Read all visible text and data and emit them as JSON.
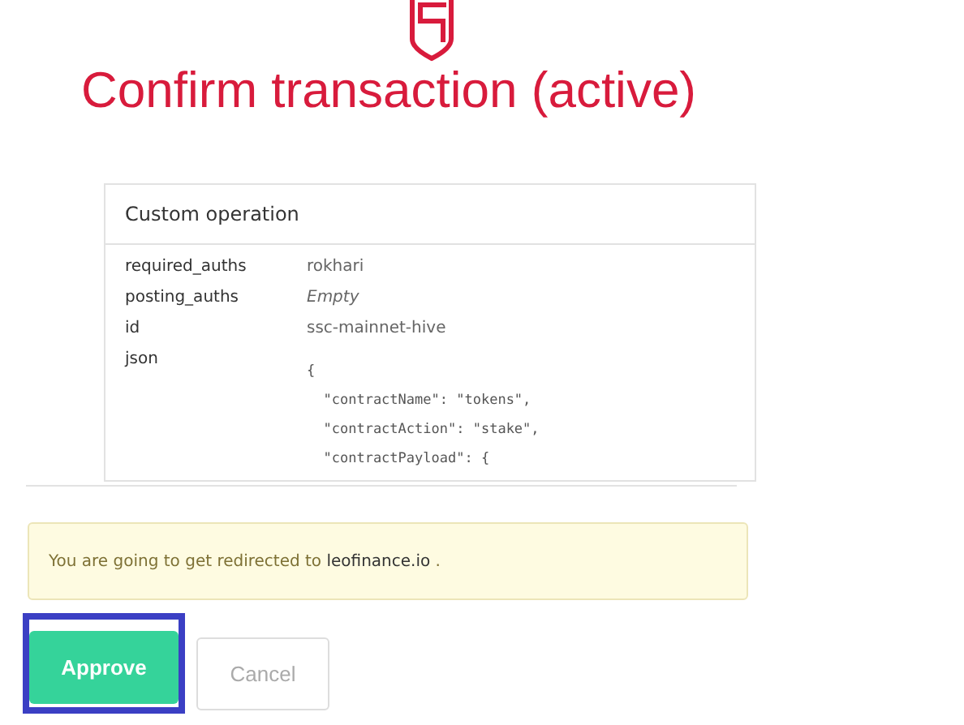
{
  "title": "Confirm transaction (active)",
  "operation": {
    "title": "Custom operation",
    "fields": [
      {
        "kind": "text",
        "label": "required_auths",
        "value": "rokhari"
      },
      {
        "kind": "empty",
        "label": "posting_auths",
        "value": "Empty"
      },
      {
        "kind": "text",
        "label": "id",
        "value": "ssc-mainnet-hive"
      },
      {
        "kind": "code",
        "label": "json",
        "lines": [
          "{",
          "  \"contractName\": \"tokens\",",
          "  \"contractAction\": \"stake\",",
          "  \"contractPayload\": {"
        ]
      }
    ]
  },
  "notice": "You are going to get redirected to **leofinance.io** .",
  "buttons": [
    {
      "kind": "primary",
      "label": "Approve",
      "highlighted": true
    },
    {
      "kind": "secondary",
      "label": "Cancel",
      "highlighted": false
    }
  ]
}
